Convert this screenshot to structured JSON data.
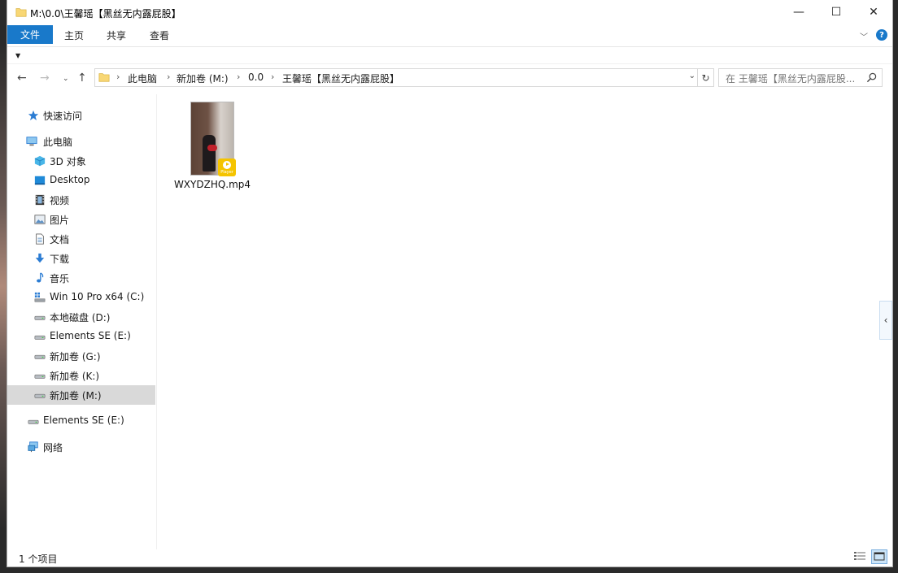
{
  "window": {
    "title": "M:\\0.0\\王馨瑶【黑丝无内露屁股】",
    "min_glyph": "—",
    "max_glyph": "☐",
    "close_glyph": "✕"
  },
  "ribbon": {
    "file_tab": "文件",
    "tabs": [
      "主页",
      "共享",
      "查看"
    ],
    "collapse_glyph": "﹀",
    "help_glyph": "?",
    "quick_access_glyph": "▼"
  },
  "nav": {
    "back_glyph": "←",
    "forward_glyph": "→",
    "recent_glyph": "⌄",
    "up_glyph": "↑"
  },
  "address": {
    "sep": "›",
    "crumbs": [
      "此电脑",
      "新加卷 (M:)",
      "0.0",
      "王馨瑶【黑丝无内露屁股】"
    ],
    "dropdown_glyph": "⌄",
    "refresh_glyph": "↻"
  },
  "search": {
    "placeholder": "在 王馨瑶【黑丝无内露屁股..."
  },
  "sidebar": {
    "items": [
      {
        "label": "快速访问",
        "icon": "star-icon"
      },
      {
        "label": "此电脑",
        "icon": "computer-icon"
      },
      {
        "label": "3D 对象",
        "icon": "cube-icon"
      },
      {
        "label": "Desktop",
        "icon": "desktop-icon"
      },
      {
        "label": "视频",
        "icon": "video-icon"
      },
      {
        "label": "图片",
        "icon": "picture-icon"
      },
      {
        "label": "文档",
        "icon": "document-icon"
      },
      {
        "label": "下载",
        "icon": "download-icon"
      },
      {
        "label": "音乐",
        "icon": "music-icon"
      },
      {
        "label": "Win 10 Pro x64 (C:)",
        "icon": "windows-drive-icon"
      },
      {
        "label": "本地磁盘 (D:)",
        "icon": "drive-icon"
      },
      {
        "label": "Elements SE (E:)",
        "icon": "drive-icon"
      },
      {
        "label": "新加卷 (G:)",
        "icon": "drive-icon"
      },
      {
        "label": "新加卷 (K:)",
        "icon": "drive-icon"
      },
      {
        "label": "新加卷 (M:)",
        "icon": "drive-icon",
        "selected": true
      },
      {
        "label": "Elements SE (E:)",
        "icon": "drive-icon"
      },
      {
        "label": "网络",
        "icon": "network-icon"
      }
    ]
  },
  "content": {
    "files": [
      {
        "name": "WXYDZHQ.mp4",
        "badge": "Player"
      }
    ]
  },
  "pane_handle_glyph": "‹",
  "status": {
    "count": "1 个项目"
  },
  "colors": {
    "accent": "#1979ca",
    "selected_bg": "#d9d9d9",
    "folder": "#f8d775",
    "badge": "#f5c400"
  }
}
